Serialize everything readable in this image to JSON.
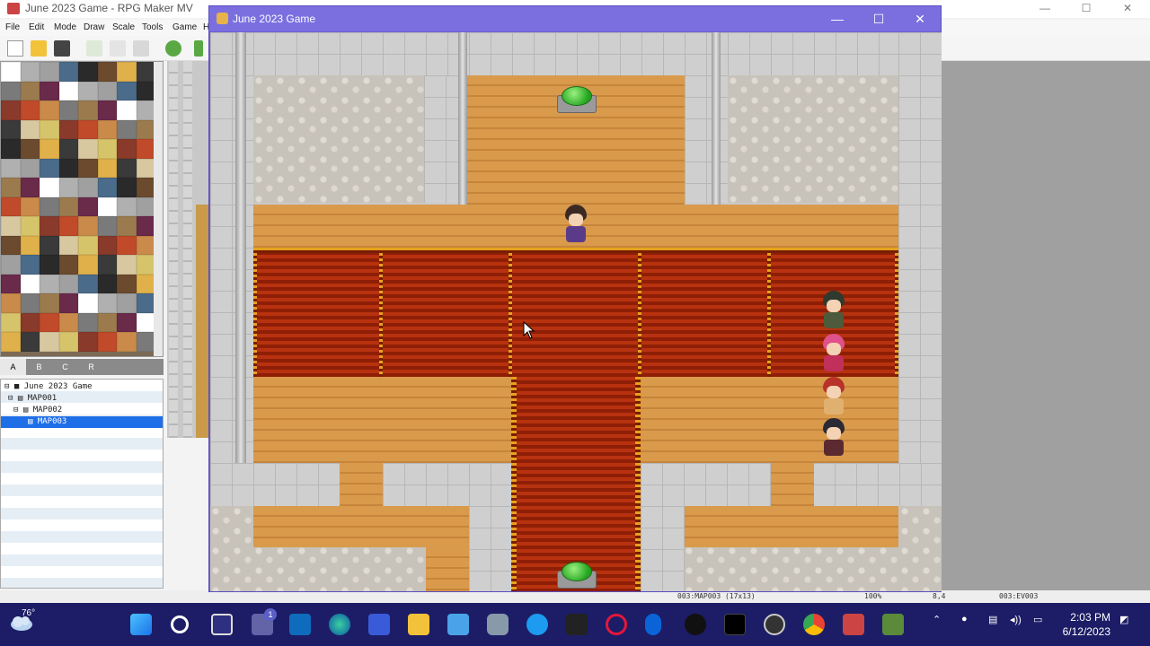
{
  "editor": {
    "title": "June 2023 Game - RPG Maker MV",
    "window_controls": {
      "minimize": "—",
      "maximize": "☐",
      "close": "✕"
    },
    "menu": [
      "File",
      "Edit",
      "Mode",
      "Draw",
      "Scale",
      "Tools",
      "Game",
      "H"
    ],
    "tileset_tabs": [
      "A",
      "B",
      "C",
      "R"
    ],
    "active_tab": "A",
    "map_tree": [
      {
        "label": "June 2023 Game",
        "level": 0,
        "selected": false
      },
      {
        "label": "MAP001",
        "level": 1,
        "selected": false
      },
      {
        "label": "MAP002",
        "level": 2,
        "selected": false
      },
      {
        "label": "MAP003",
        "level": 3,
        "selected": true
      }
    ],
    "status": {
      "map": "003:MAP003 (17x13)",
      "zoom": "100%",
      "coords": "8,4",
      "event": "003:EV003"
    }
  },
  "game_window": {
    "title": "June 2023 Game",
    "controls": {
      "minimize": "—",
      "maximize": "☐",
      "close": "✕"
    },
    "characters": [
      {
        "name": "player-character",
        "hair": "#3b2a24",
        "body": "#5a3b8a"
      },
      {
        "name": "party-member-green",
        "hair": "#2f3a2e",
        "body": "#4d5a3c"
      },
      {
        "name": "party-member-pink",
        "hair": "#e0508a",
        "body": "#c0305a"
      },
      {
        "name": "party-member-red",
        "hair": "#b8322a",
        "body": "#e0b070"
      },
      {
        "name": "party-member-dark",
        "hair": "#2a2a35",
        "body": "#5a2a30"
      }
    ],
    "accent_colors": {
      "title_bar": "#7b6fe0",
      "switch_button": "#23a51f"
    }
  },
  "taskbar": {
    "weather_temp": "76°",
    "apps": [
      "start-icon",
      "search-icon",
      "task-view-icon",
      "teams-icon",
      "store-icon",
      "edge-icon",
      "vscode-icon",
      "file-explorer-icon",
      "photos-icon",
      "camera-icon",
      "twitter-icon",
      "affinity-icon",
      "opera-icon",
      "bluetooth-icon",
      "settings-icon",
      "terminal-icon",
      "obs-icon",
      "chrome-icon",
      "rpgmaker-icon",
      "game-icon"
    ],
    "clock_time": "2:03 PM",
    "clock_date": "6/12/2023",
    "chat_badge": "1"
  }
}
